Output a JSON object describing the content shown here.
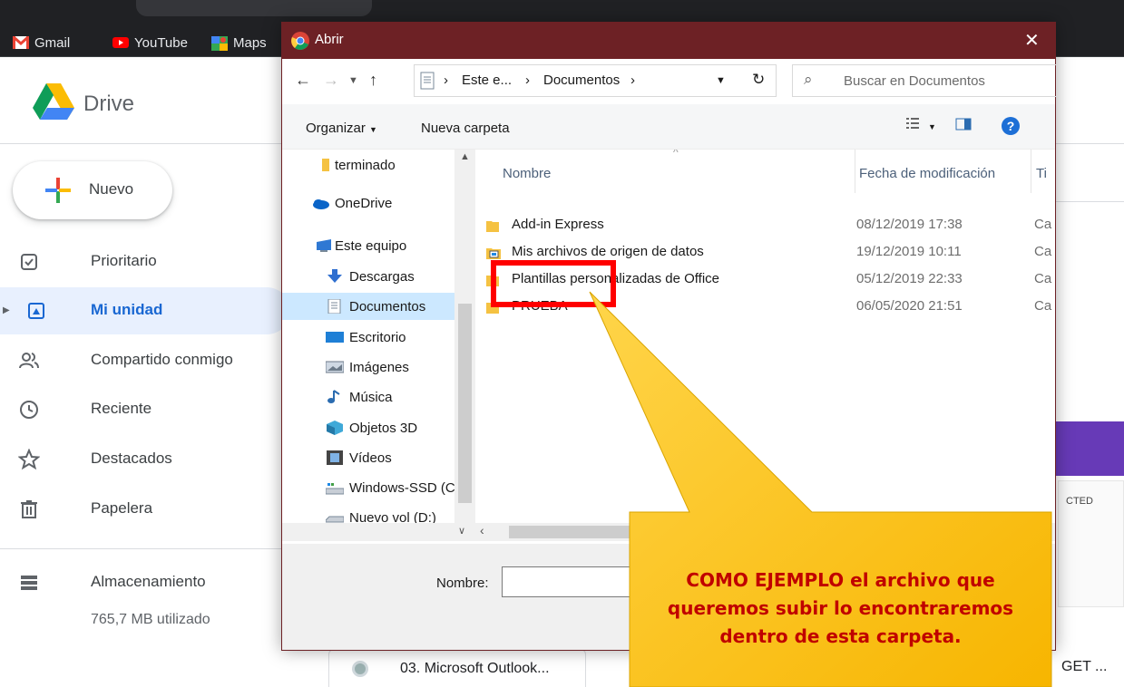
{
  "browser": {
    "bookmarks": [
      {
        "label": "Gmail",
        "icon": "gmail-icon"
      },
      {
        "label": "YouTube",
        "icon": "youtube-icon"
      },
      {
        "label": "Maps",
        "icon": "maps-icon"
      }
    ]
  },
  "drive": {
    "title": "Drive",
    "new_label": "Nuevo",
    "nav": [
      {
        "label": "Prioritario",
        "icon": "priority-icon",
        "active": false
      },
      {
        "label": "Mi unidad",
        "icon": "my-drive-icon",
        "active": true
      },
      {
        "label": "Compartido conmigo",
        "icon": "shared-icon",
        "active": false
      },
      {
        "label": "Reciente",
        "icon": "clock-icon",
        "active": false
      },
      {
        "label": "Destacados",
        "icon": "star-icon",
        "active": false
      },
      {
        "label": "Papelera",
        "icon": "trash-icon",
        "active": false
      }
    ],
    "storage_label": "Almacenamiento",
    "storage_used": "765,7 MB utilizado",
    "file_card": "03. Microsoft Outlook...",
    "thumb_text": "CTED",
    "tail_text": "GET ..."
  },
  "dialog": {
    "title": "Abrir",
    "breadcrumb": [
      "Este e...",
      "Documentos"
    ],
    "search_placeholder": "Buscar en Documentos",
    "organize": "Organizar",
    "new_folder": "Nueva carpeta",
    "nav_pane": [
      {
        "label": "terminado",
        "icon": "folder-icon"
      },
      {
        "label": "OneDrive",
        "icon": "onedrive-icon"
      },
      {
        "label": "Este equipo",
        "icon": "this-pc-icon"
      },
      {
        "label": "Descargas",
        "icon": "download-icon"
      },
      {
        "label": "Documentos",
        "icon": "documents-icon",
        "selected": true
      },
      {
        "label": "Escritorio",
        "icon": "desktop-icon"
      },
      {
        "label": "Imágenes",
        "icon": "pictures-icon"
      },
      {
        "label": "Música",
        "icon": "music-icon"
      },
      {
        "label": "Objetos 3D",
        "icon": "objects-3d-icon"
      },
      {
        "label": "Vídeos",
        "icon": "videos-icon"
      },
      {
        "label": "Windows-SSD (C",
        "icon": "drive-c-icon"
      },
      {
        "label": "Nuevo vol (D:)",
        "icon": "drive-d-icon"
      }
    ],
    "columns": {
      "name": "Nombre",
      "date": "Fecha de modificación",
      "type": "Ti"
    },
    "files": [
      {
        "name": "Add-in Express",
        "date": "08/12/2019 17:38",
        "type": "Ca"
      },
      {
        "name": "Mis archivos de origen de datos",
        "date": "19/12/2019 10:11",
        "type": "Ca"
      },
      {
        "name": "Plantillas personalizadas de Office",
        "date": "05/12/2019 22:33",
        "type": "Ca"
      },
      {
        "name": "PRUEBA",
        "date": "06/05/2020 21:51",
        "type": "Ca"
      }
    ],
    "filename_label": "Nombre:",
    "filename_value": ""
  },
  "callout": {
    "lines": [
      "COMO EJEMPLO el archivo que",
      "queremos subir lo encontraremos",
      "dentro de esta carpeta."
    ],
    "fill": "#fcc300",
    "text_color": "#c00000",
    "highlight_color": "#ff0000"
  }
}
